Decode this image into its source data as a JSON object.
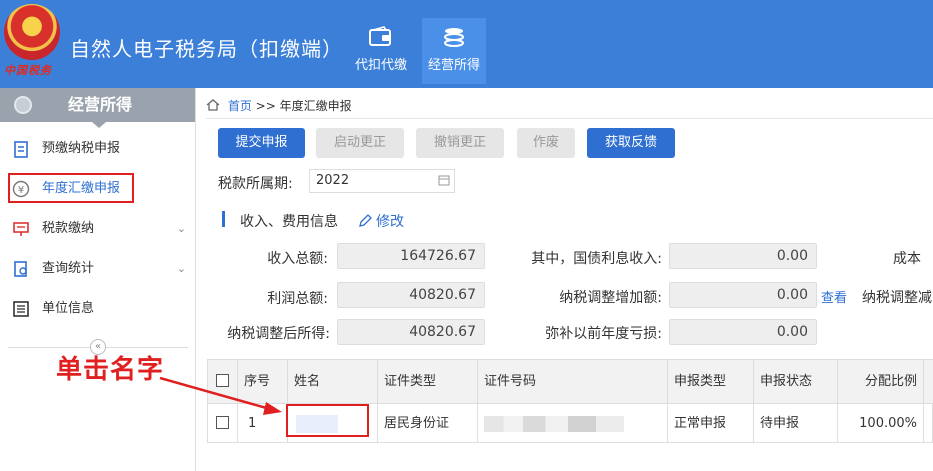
{
  "header": {
    "emblem_text": "中国税务",
    "app_title": "自然人电子税务局（扣缴端）",
    "nav": [
      {
        "label": "代扣代缴",
        "icon": "wallet-icon"
      },
      {
        "label": "经营所得",
        "icon": "coins-icon",
        "active": true
      }
    ]
  },
  "sidebar": {
    "title": "经营所得",
    "items": [
      {
        "label": "预缴纳税申报",
        "icon": "clipboard-icon"
      },
      {
        "label": "年度汇缴申报",
        "icon": "yen-icon",
        "selected": true
      },
      {
        "label": "税款缴纳",
        "icon": "payment-icon",
        "expandable": true
      },
      {
        "label": "查询统计",
        "icon": "query-icon",
        "expandable": true
      },
      {
        "label": "单位信息",
        "icon": "list-icon"
      }
    ],
    "collapse_glyph": "«"
  },
  "annotation": {
    "text": "单击名字"
  },
  "breadcrumb": {
    "home": "首页",
    "sep": ">>",
    "current": "年度汇缴申报"
  },
  "toolbar": {
    "buttons": [
      {
        "label": "提交申报",
        "enabled": true
      },
      {
        "label": "启动更正",
        "enabled": false
      },
      {
        "label": "撤销更正",
        "enabled": false
      },
      {
        "label": "作废",
        "enabled": false
      },
      {
        "label": "获取反馈",
        "enabled": true
      }
    ]
  },
  "period": {
    "label": "税款所属期:",
    "value": "2022"
  },
  "section": {
    "title": "收入、费用信息",
    "edit": "修改"
  },
  "fields": {
    "total_income": {
      "label": "收入总额:",
      "value": "164726.67"
    },
    "bond_interest": {
      "label": "其中，国债利息收入:",
      "value": "0.00"
    },
    "cost_partial": {
      "label": "成本"
    },
    "total_profit": {
      "label": "利润总额:",
      "value": "40820.67"
    },
    "tax_adj_increase": {
      "label": "纳税调整增加额:",
      "value": "0.00"
    },
    "view_link": "查看",
    "tax_adj_decrease_partial": {
      "label": "纳税调整减"
    },
    "adjusted_income": {
      "label": "纳税调整后所得:",
      "value": "40820.67"
    },
    "loss_offset": {
      "label": "弥补以前年度亏损:",
      "value": "0.00"
    }
  },
  "table": {
    "headers": [
      "序号",
      "姓名",
      "证件类型",
      "证件号码",
      "申报类型",
      "申报状态",
      "分配比例"
    ],
    "rows": [
      {
        "index": "1",
        "id_type": "居民身份证",
        "report_type": "正常申报",
        "status": "待申报",
        "ratio": "100.00%"
      }
    ]
  },
  "colors": {
    "accent": "#2f6fd1",
    "header": "#3b7fd9",
    "annotation": "#e02020"
  }
}
